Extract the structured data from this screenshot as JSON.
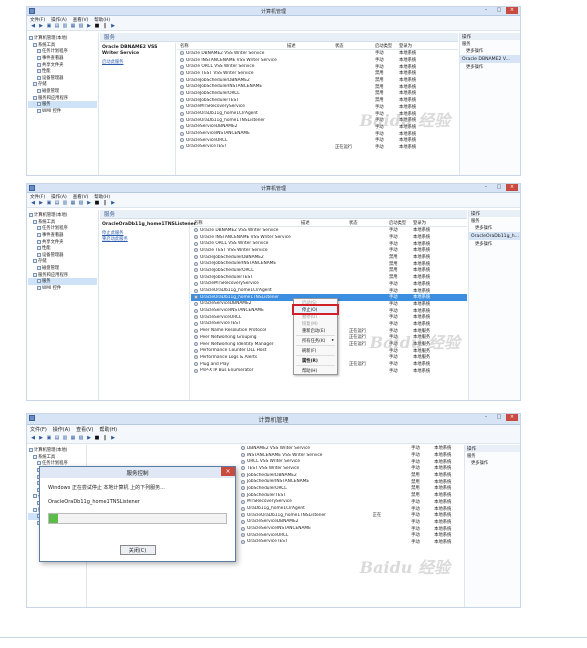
{
  "window_title": "计算机管理",
  "menu": [
    "文件(F)",
    "操作(A)",
    "查看(V)",
    "帮助(H)"
  ],
  "tree": [
    {
      "label": "计算机管理(本地)",
      "indent": 0
    },
    {
      "label": "系统工具",
      "indent": 1
    },
    {
      "label": "任务计划程序",
      "indent": 2
    },
    {
      "label": "事件查看器",
      "indent": 2
    },
    {
      "label": "共享文件夹",
      "indent": 2
    },
    {
      "label": "性能",
      "indent": 2
    },
    {
      "label": "设备管理器",
      "indent": 2
    },
    {
      "label": "存储",
      "indent": 1
    },
    {
      "label": "磁盘管理",
      "indent": 2
    },
    {
      "label": "服务和应用程序",
      "indent": 1
    },
    {
      "label": "服务",
      "indent": 2,
      "selected": true
    },
    {
      "label": "WMI 控件",
      "indent": 2
    }
  ],
  "services_header": "服务",
  "columns": {
    "name": "名称",
    "desc": "描述",
    "status": "状态",
    "startup": "启动类型",
    "login": "登录为"
  },
  "actions_title": "操作",
  "actions_services": "服务",
  "more_actions": "更多操作",
  "desc_links": [
    "停止此服务",
    "重启动此服务"
  ],
  "panels": [
    {
      "selected_name": "Oracle DBNAME2 VSS Writer Service",
      "desc_link_single": "启动此服务",
      "action_sub": "Oracle DBNAME2 V...",
      "rows": [
        {
          "name": "Oracle DBNAME2 VSS Writer Service",
          "status": "",
          "startup": "手动",
          "login": "本地系统"
        },
        {
          "name": "Oracle INSTANCENAME VSS Writer Service",
          "status": "",
          "startup": "手动",
          "login": "本地系统"
        },
        {
          "name": "Oracle ORCL VSS Writer Service",
          "status": "",
          "startup": "手动",
          "login": "本地系统"
        },
        {
          "name": "Oracle TEST VSS Writer Service",
          "status": "",
          "startup": "禁用",
          "login": "本地系统"
        },
        {
          "name": "OracleJobSchedulerDBNAME2",
          "status": "",
          "startup": "禁用",
          "login": "本地系统"
        },
        {
          "name": "OracleJobSchedulerINSTANCENAME",
          "status": "",
          "startup": "禁用",
          "login": "本地系统"
        },
        {
          "name": "OracleJobSchedulerORCL",
          "status": "",
          "startup": "禁用",
          "login": "本地系统"
        },
        {
          "name": "OracleJobSchedulerTEST",
          "status": "",
          "startup": "禁用",
          "login": "本地系统"
        },
        {
          "name": "OracleMTSRecoveryService",
          "status": "",
          "startup": "手动",
          "login": "本地系统"
        },
        {
          "name": "OracleOraDb11g_home1ClrAgent",
          "status": "",
          "startup": "手动",
          "login": "本地系统"
        },
        {
          "name": "OracleOraDb11g_home1TNSListener",
          "status": "",
          "startup": "手动",
          "login": "本地系统"
        },
        {
          "name": "OracleServiceDBNAME2",
          "status": "",
          "startup": "手动",
          "login": "本地系统"
        },
        {
          "name": "OracleServiceINSTANCENAME",
          "status": "",
          "startup": "手动",
          "login": "本地系统"
        },
        {
          "name": "OracleServiceORCL",
          "status": "",
          "startup": "手动",
          "login": "本地系统"
        },
        {
          "name": "OracleServiceTEST",
          "status": "正在运行",
          "startup": "手动",
          "login": "本地系统"
        }
      ]
    },
    {
      "selected_name": "OracleOraDb11g_home1TNSListener",
      "action_sub": "OracleOraDb11g_h...",
      "rows": [
        {
          "name": "Oracle DBNAME2 VSS Writer Service",
          "status": "",
          "startup": "手动",
          "login": "本地系统"
        },
        {
          "name": "Oracle INSTANCENAME VSS Writer Service",
          "status": "",
          "startup": "手动",
          "login": "本地系统"
        },
        {
          "name": "Oracle ORCL VSS Writer Service",
          "status": "",
          "startup": "手动",
          "login": "本地系统"
        },
        {
          "name": "Oracle TEST VSS Writer Service",
          "status": "",
          "startup": "手动",
          "login": "本地系统"
        },
        {
          "name": "OracleJobSchedulerDBNAME2",
          "status": "",
          "startup": "禁用",
          "login": "本地系统"
        },
        {
          "name": "OracleJobSchedulerINSTANCENAME",
          "status": "",
          "startup": "禁用",
          "login": "本地系统"
        },
        {
          "name": "OracleJobSchedulerORCL",
          "status": "",
          "startup": "禁用",
          "login": "本地系统"
        },
        {
          "name": "OracleJobSchedulerTEST",
          "status": "",
          "startup": "禁用",
          "login": "本地系统"
        },
        {
          "name": "OracleMTSRecoveryService",
          "status": "",
          "startup": "手动",
          "login": "本地系统"
        },
        {
          "name": "OracleOraDb11g_home1ClrAgent",
          "status": "",
          "startup": "手动",
          "login": "本地系统"
        },
        {
          "name": "OracleOraDb11g_home1TNSListener",
          "status": "",
          "startup": "手动",
          "login": "本地系统",
          "selected": true
        },
        {
          "name": "OracleServiceDBNAME2",
          "status": "",
          "startup": "手动",
          "login": "本地系统"
        },
        {
          "name": "OracleServiceINSTANCENAME",
          "status": "",
          "startup": "手动",
          "login": "本地系统"
        },
        {
          "name": "OracleServiceORCL",
          "status": "",
          "startup": "手动",
          "login": "本地系统"
        },
        {
          "name": "OracleServiceTEST",
          "status": "",
          "startup": "手动",
          "login": "本地系统"
        },
        {
          "name": "Peer Name Resolution Protocol",
          "status": "正在运行",
          "startup": "手动",
          "login": "本地服务"
        },
        {
          "name": "Peer Networking Grouping",
          "status": "正在运行",
          "startup": "手动",
          "login": "本地服务"
        },
        {
          "name": "Peer Networking Identity Manager",
          "status": "正在运行",
          "startup": "手动",
          "login": "本地服务"
        },
        {
          "name": "Performance Counter DLL Host",
          "status": "",
          "startup": "手动",
          "login": "本地服务"
        },
        {
          "name": "Performance Logs & Alerts",
          "status": "",
          "startup": "手动",
          "login": "本地服务"
        },
        {
          "name": "Plug and Play",
          "status": "正在运行",
          "startup": "手动",
          "login": "本地系统"
        },
        {
          "name": "PnP-X IP Bus Enumerator",
          "status": "",
          "startup": "手动",
          "login": "本地系统"
        }
      ],
      "context_menu": [
        {
          "label": "启动(S)",
          "disabled": true
        },
        {
          "label": "停止(O)",
          "highlighted": true
        },
        {
          "label": "暂停(U)",
          "disabled": true
        },
        {
          "label": "恢复(M)",
          "disabled": true
        },
        {
          "label": "重新启动(E)"
        },
        {
          "sep": true
        },
        {
          "label": "所有任务(K)",
          "arrow": "▸"
        },
        {
          "sep": true
        },
        {
          "label": "刷新(F)"
        },
        {
          "sep": true
        },
        {
          "label": "属性(R)",
          "bold": true
        },
        {
          "sep": true
        },
        {
          "label": "帮助(H)"
        }
      ]
    },
    {
      "rows": [
        {
          "name": "DBNAME2 VSS Writer Service",
          "status": "",
          "startup": "手动",
          "login": "本地系统"
        },
        {
          "name": "INSTANCENAME VSS Writer Service",
          "status": "",
          "startup": "手动",
          "login": "本地系统"
        },
        {
          "name": "ORCL VSS Writer Service",
          "status": "",
          "startup": "手动",
          "login": "本地系统"
        },
        {
          "name": "TEST VSS Writer Service",
          "status": "",
          "startup": "手动",
          "login": "本地系统"
        },
        {
          "name": "JobSchedulerDBNAME2",
          "status": "",
          "startup": "禁用",
          "login": "本地系统"
        },
        {
          "name": "JobSchedulerINSTANCENAME",
          "status": "",
          "startup": "禁用",
          "login": "本地系统"
        },
        {
          "name": "JobSchedulerORCL",
          "status": "",
          "startup": "禁用",
          "login": "本地系统"
        },
        {
          "name": "JobSchedulerTEST",
          "status": "",
          "startup": "禁用",
          "login": "本地系统"
        },
        {
          "name": "MTSRecoveryService",
          "status": "",
          "startup": "手动",
          "login": "本地系统"
        },
        {
          "name": "OraDb11g_home1ClrAgent",
          "status": "",
          "startup": "手动",
          "login": "本地系统"
        },
        {
          "name": "OracleOraDb11g_home1TNSListener",
          "status": "正在",
          "startup": "手动",
          "login": "本地系统"
        },
        {
          "name": "OracleServiceDBNAME2",
          "status": "",
          "startup": "手动",
          "login": "本地系统"
        },
        {
          "name": "OracleServiceINSTANCENAME",
          "status": "",
          "startup": "手动",
          "login": "本地系统"
        },
        {
          "name": "OracleServiceORCL",
          "status": "",
          "startup": "手动",
          "login": "本地系统"
        },
        {
          "name": "OracleServiceTEST",
          "status": "",
          "startup": "手动",
          "login": "本地系统"
        }
      ],
      "dialog": {
        "title": "服务控制",
        "message": "Windows 正在尝试停止 本地计算机 上的下列服务...",
        "service": "OracleOraDb11g_home1TNSListener",
        "progress": 0.05,
        "close_label": "关闭(C)"
      }
    }
  ],
  "watermark": "Baidu 经验",
  "colors": {
    "selection": "#3b8ee0",
    "highlight_box": "#d0202a",
    "titlebar": "#d6e4f5",
    "progress": "#5dbb4a"
  }
}
